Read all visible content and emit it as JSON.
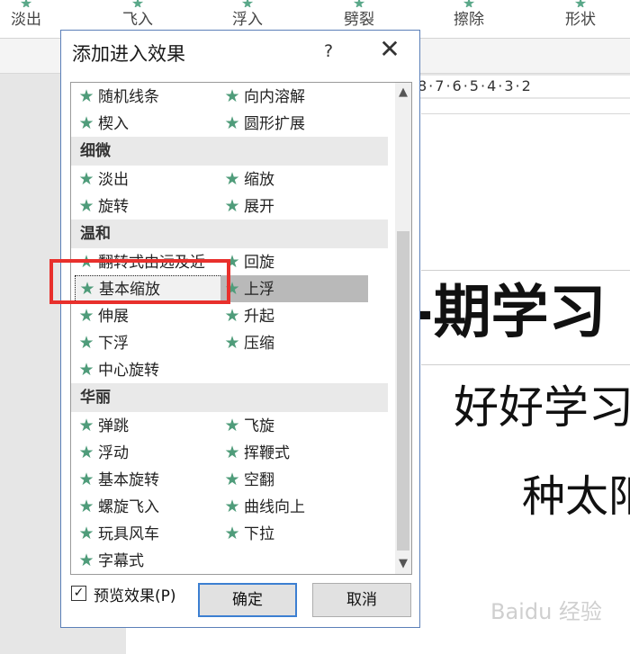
{
  "ribbon": {
    "items": [
      {
        "label": "淡出",
        "icon": "star-icon"
      },
      {
        "label": "飞入",
        "icon": "star-icon"
      },
      {
        "label": "浮入",
        "icon": "star-icon"
      },
      {
        "label": "劈裂",
        "icon": "star-icon"
      },
      {
        "label": "擦除",
        "icon": "star-icon"
      },
      {
        "label": "形状",
        "icon": "star-icon"
      }
    ]
  },
  "document": {
    "ruler_text": "8·7·6·5·4·3·2",
    "title": "-期学习",
    "subtitle1": "好好学习",
    "subtitle2": "种太阳",
    "watermark": "Baidu 经验"
  },
  "dialog": {
    "title": "添加进入效果",
    "help": "?",
    "close": "✕",
    "rows": [
      {
        "type": "items",
        "left": "随机线条",
        "right": "向内溶解"
      },
      {
        "type": "items",
        "left": "楔入",
        "right": "圆形扩展"
      },
      {
        "type": "category",
        "label": "细微"
      },
      {
        "type": "items",
        "left": "淡出",
        "right": "缩放"
      },
      {
        "type": "items",
        "left": "旋转",
        "right": "展开"
      },
      {
        "type": "category",
        "label": "温和"
      },
      {
        "type": "items",
        "left": "翻转式由远及近",
        "right": "回旋"
      },
      {
        "type": "items",
        "left": "基本缩放",
        "right": "上浮"
      },
      {
        "type": "items",
        "left": "伸展",
        "right": "升起"
      },
      {
        "type": "items",
        "left": "下浮",
        "right": "压缩"
      },
      {
        "type": "items",
        "left": "中心旋转",
        "right": ""
      },
      {
        "type": "category",
        "label": "华丽"
      },
      {
        "type": "items",
        "left": "弹跳",
        "right": "飞旋"
      },
      {
        "type": "items",
        "left": "浮动",
        "right": "挥鞭式"
      },
      {
        "type": "items",
        "left": "基本旋转",
        "right": "空翻"
      },
      {
        "type": "items",
        "left": "螺旋飞入",
        "right": "曲线向上"
      },
      {
        "type": "items",
        "left": "玩具风车",
        "right": "下拉"
      },
      {
        "type": "items",
        "left": "字幕式",
        "right": ""
      }
    ],
    "focused_item": "基本缩放",
    "selected_item": "上浮",
    "preview_label": "预览效果(P)",
    "preview_checked": true,
    "ok_label": "确定",
    "cancel_label": "取消"
  },
  "colors": {
    "star": "#4f9c7a",
    "annotation": "#e8302c",
    "dialog_border": "#5b7fb8"
  }
}
